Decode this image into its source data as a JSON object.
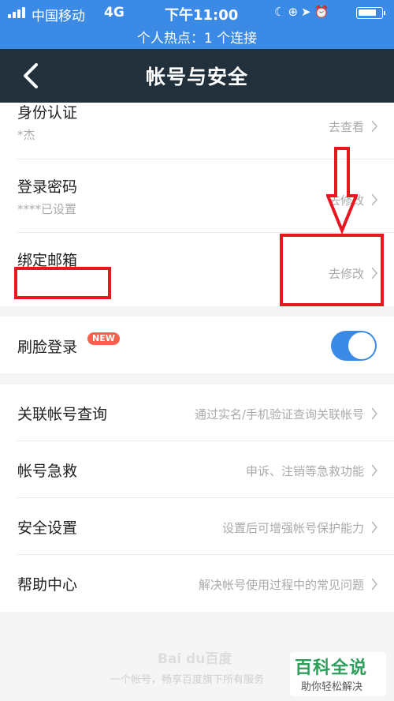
{
  "status_bar": {
    "carrier": "中国移动",
    "network": "4G",
    "time": "下午11:00",
    "hotspot": "个人热点：1 个连接",
    "icons": [
      "moon-icon",
      "lock-rotation-icon",
      "location-icon",
      "alarm-icon",
      "battery-icon"
    ],
    "color": "#3a8ae6"
  },
  "nav": {
    "title": "帐号与安全",
    "back_icon": "back-chevron-icon",
    "color": "#22303c"
  },
  "rows": [
    {
      "label": "身份认证",
      "sub": "*杰",
      "action": "去查看"
    },
    {
      "label": "登录密码",
      "sub": "****已设置",
      "action": "去修改"
    },
    {
      "label": "绑定邮箱",
      "sub": "",
      "action": "去修改"
    }
  ],
  "face_login": {
    "label": "刷脸登录",
    "badge": "NEW",
    "toggle_on": true
  },
  "more_rows": [
    {
      "label": "关联帐号查询",
      "action": "通过实名/手机验证查询关联帐号"
    },
    {
      "label": "帐号急救",
      "action": "申诉、注销等急救功能"
    },
    {
      "label": "安全设置",
      "action": "设置后可增强帐号保护能力"
    },
    {
      "label": "帮助中心",
      "action": "解决帐号使用过程中的常见问题"
    }
  ],
  "footer": {
    "logo": "Bai du百度",
    "tagline": "一个帐号，畅享百度旗下所有服务"
  },
  "watermark": {
    "main": "百科全说",
    "sub": "助你轻松解决"
  },
  "annotation_color": "#e8171f"
}
